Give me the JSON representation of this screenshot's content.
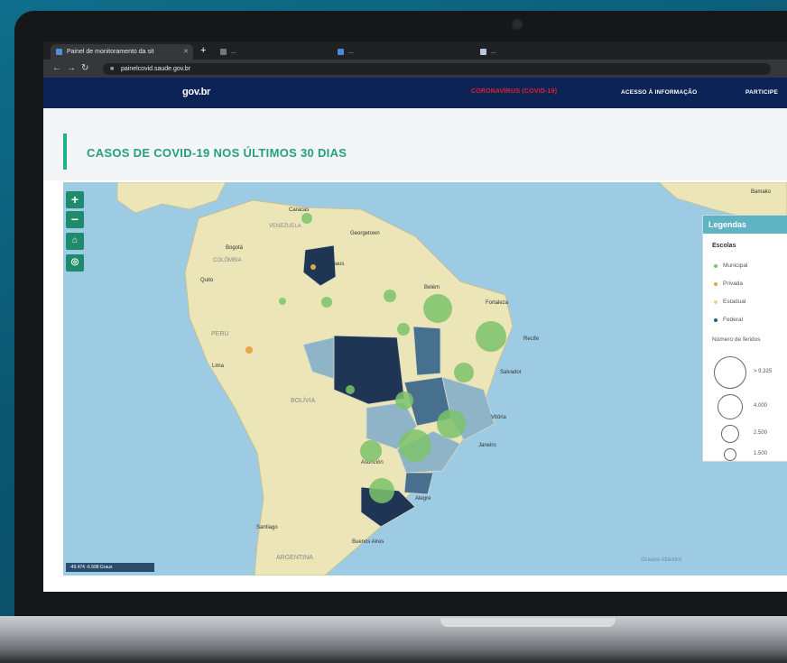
{
  "browser": {
    "tabs": [
      {
        "label": "Painel de monitoramento da sit"
      },
      {
        "label": "..."
      },
      {
        "label": "..."
      },
      {
        "label": "..."
      }
    ],
    "url": "painelcovid.saude.gov.br"
  },
  "gov_header": {
    "logo": "gov.br",
    "links": [
      "CORONAVÍRUS (COVID-19)",
      "ACESSO À INFORMAÇÃO",
      "PARTICIPE"
    ]
  },
  "page": {
    "title": "CASOS DE COVID-19 NOS ÚLTIMOS 30 DIAS"
  },
  "map": {
    "place_labels": [
      "Caracas",
      "Bogotá",
      "Quito",
      "Lima",
      "Belém",
      "Fortaleza",
      "Recife",
      "Salvador",
      "Vitória",
      "Janeiro",
      "Alegre",
      "Buenos Aires",
      "Santiago",
      "Asunción",
      "BOLÍVIA",
      "PERU",
      "ARGENTINA",
      "VENEZUELA",
      "COLÔMBIA",
      "Bamako",
      "Georgetown",
      "Manaus"
    ],
    "scale_text": "-49.474 -6.998 Graus",
    "attribution": "Oceano Atlântico",
    "legend": {
      "title": "Legendas",
      "schools_label": "Escolas",
      "schools": [
        {
          "label": "Municipal",
          "color": "#7fbf6f"
        },
        {
          "label": "Privada",
          "color": "#e3a64a"
        },
        {
          "label": "Estadual",
          "color": "#f2d27a"
        },
        {
          "label": "Federal",
          "color": "#2e5a7d"
        }
      ],
      "size_label": "Número de feridos",
      "sizes": [
        "> 9.325",
        "4.000",
        "2.500",
        "1.500"
      ]
    },
    "colors": {
      "ocean": "#9dcbe3",
      "land": "#ece5b8",
      "dark_state": "#1e3554",
      "mid_state": "#47708f",
      "light_state": "#8fb4c8",
      "bubble": "#7cc36a"
    }
  }
}
